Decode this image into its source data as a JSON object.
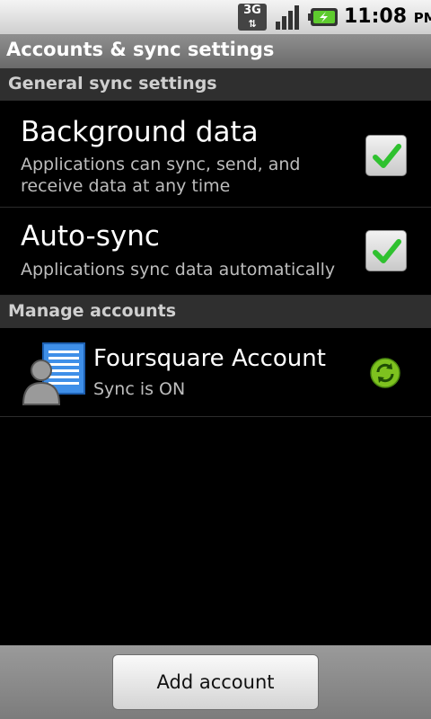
{
  "status_bar": {
    "network": "3G",
    "time": "11:08",
    "ampm": "PM",
    "icons": [
      "3g-data-icon",
      "signal-strength-icon",
      "battery-charging-icon"
    ]
  },
  "title": "Accounts & sync settings",
  "general": {
    "header": "General sync settings",
    "background_data": {
      "title": "Background data",
      "summary": "Applications can sync, send, and receive data at any time",
      "checked": true
    },
    "auto_sync": {
      "title": "Auto-sync",
      "summary": "Applications sync data automatically",
      "checked": true
    }
  },
  "manage": {
    "header": "Manage accounts",
    "accounts": [
      {
        "name": "Foursquare Account",
        "status": "Sync is ON",
        "icon": "account-person-icon",
        "sync_icon": "sync-on-icon"
      }
    ]
  },
  "add_account_label": "Add account",
  "colors": {
    "check_green": "#2fc12f",
    "sync_green": "#7ec21f",
    "account_blue": "#3f8fe8"
  }
}
